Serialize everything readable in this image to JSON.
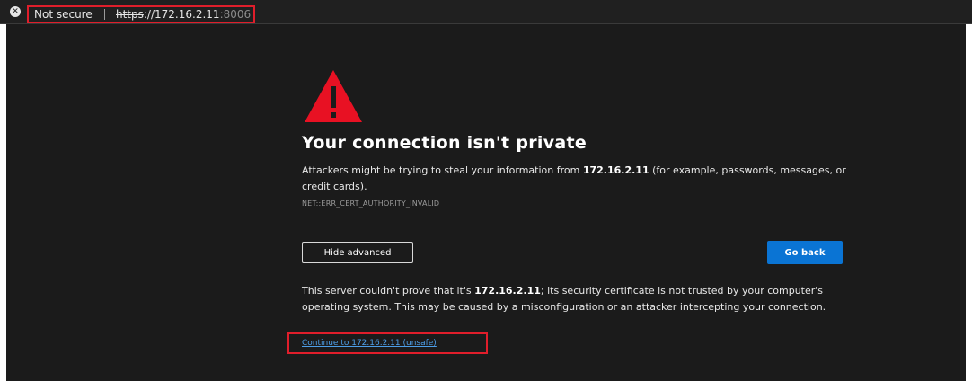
{
  "address_bar": {
    "security_label": "Not secure",
    "url_scheme": "https",
    "url_sep": "://",
    "url_host": "172.16.2.11",
    "url_port": ":8006"
  },
  "page": {
    "title": "Your connection isn't private",
    "desc_prefix": "Attackers might be trying to steal your information from ",
    "desc_host": "172.16.2.11",
    "desc_suffix": " (for example, passwords, messages, or credit cards).",
    "error_code": "NET::ERR_CERT_AUTHORITY_INVALID",
    "hide_advanced_label": "Hide advanced",
    "go_back_label": "Go back",
    "explain_prefix": "This server couldn't prove that it's ",
    "explain_host": "172.16.2.11",
    "explain_suffix": "; its security certificate is not trusted by your computer's operating system. This may be caused by a misconfiguration or an attacker intercepting your connection.",
    "continue_link": "Continue to 172.16.2.11 (unsafe)"
  },
  "colors": {
    "page_bg": "#1b1b1b",
    "warning_red": "#e81123",
    "go_back_blue": "#0a74d4",
    "link_blue": "#4d9ee8",
    "highlight_red": "#e01e2b"
  },
  "icons": {
    "security": "not-secure-icon",
    "warning": "warning-triangle-icon"
  }
}
